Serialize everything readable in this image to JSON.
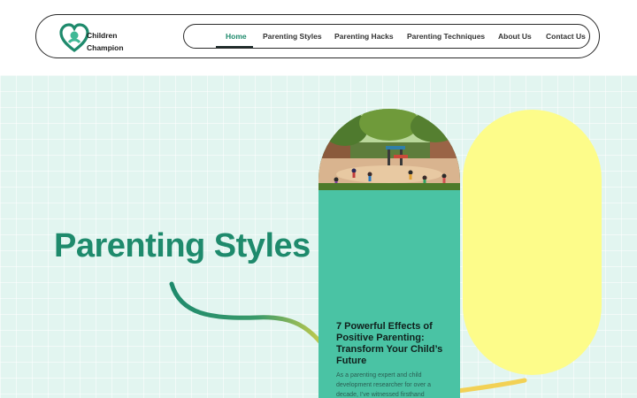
{
  "brand": {
    "line1": "Children",
    "line2": "Champion",
    "logo_icon": "heart-icon",
    "color": "#1e8a6c"
  },
  "nav": {
    "items": [
      {
        "label": "Home",
        "active": true
      },
      {
        "label": "Parenting Styles"
      },
      {
        "label": "Parenting Hacks"
      },
      {
        "label": "Parenting Techniques"
      },
      {
        "label": "About Us"
      },
      {
        "label": "Contact Us"
      }
    ]
  },
  "hero": {
    "title": "Parenting Styles",
    "accent": "#1e8a6c",
    "background": "#e2f5f0"
  },
  "card": {
    "title": "7 Powerful Effects of Positive Parenting: Transform Your Child’s Future",
    "excerpt": "As a parenting expert and child development researcher for over a decade, I’ve witnessed firsthand",
    "color": "#4ac3a4",
    "image_desc": "park-playground-image"
  },
  "decor": {
    "yellow": "#fdfc8a"
  }
}
